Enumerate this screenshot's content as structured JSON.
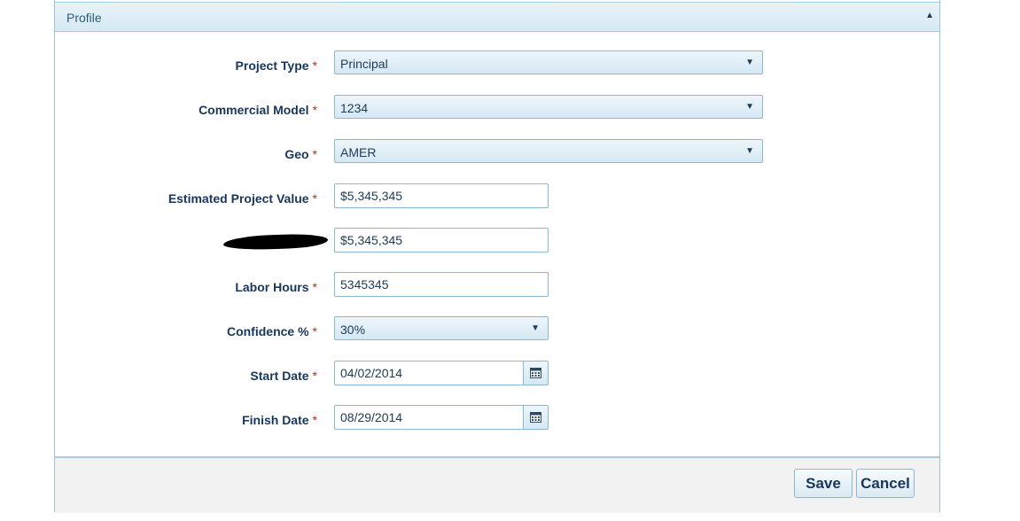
{
  "panel": {
    "title": "Profile"
  },
  "form": {
    "project_type": {
      "label": "Project Type",
      "required": "*",
      "value": "Principal"
    },
    "commercial_model": {
      "label": "Commercial Model",
      "required": "*",
      "value": "1234"
    },
    "geo": {
      "label": "Geo",
      "required": "*",
      "value": "AMER"
    },
    "estimated_project_value": {
      "label": "Estimated Project Value",
      "required": "*",
      "value": "$5,345,345"
    },
    "redacted_field": {
      "value": "$5,345,345"
    },
    "labor_hours": {
      "label": "Labor Hours",
      "required": "*",
      "value": "5345345"
    },
    "confidence": {
      "label": "Confidence %",
      "required": "*",
      "value": "30%"
    },
    "start_date": {
      "label": "Start Date",
      "required": "*",
      "value": "04/02/2014"
    },
    "finish_date": {
      "label": "Finish Date",
      "required": "*",
      "value": "08/29/2014"
    }
  },
  "icons": {
    "collapse": "triangle-up-icon",
    "dropdown": "triangle-down-icon",
    "calendar": "calendar-icon"
  },
  "footer": {
    "save_label": "Save",
    "cancel_label": "Cancel"
  },
  "colors": {
    "label": "#17365d",
    "required": "#d21f1f",
    "border": "#8db6cf",
    "header_bg": "#d6e9f4"
  }
}
